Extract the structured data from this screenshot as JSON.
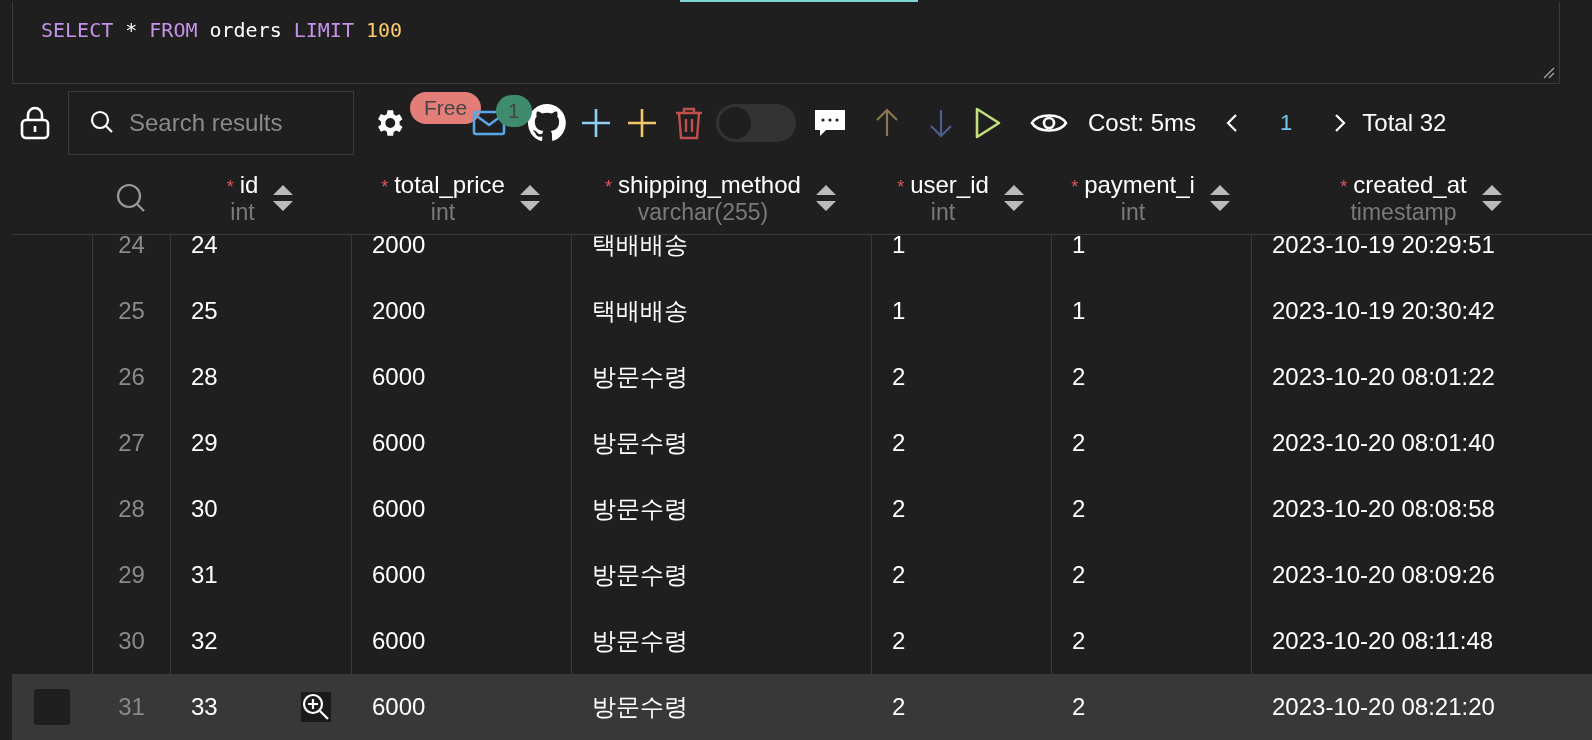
{
  "query": {
    "tokens": [
      {
        "kind": "keyword",
        "text": "SELECT"
      },
      {
        "kind": "plain",
        "text": "*"
      },
      {
        "kind": "keyword",
        "text": "FROM"
      },
      {
        "kind": "plain",
        "text": "orders"
      },
      {
        "kind": "keyword",
        "text": "LIMIT"
      },
      {
        "kind": "number",
        "text": "100"
      }
    ]
  },
  "toolbar": {
    "search": {
      "placeholder": "Search results"
    },
    "plan_badge": "Free",
    "mail_badge": "1",
    "toggle": {
      "on": false
    },
    "cost": "Cost: 5ms",
    "page": "1",
    "total": "Total 32"
  },
  "table": {
    "columns": [
      {
        "name": "id",
        "type": "int",
        "required": true
      },
      {
        "name": "total_price",
        "type": "int",
        "required": true
      },
      {
        "name": "shipping_method",
        "type": "varchar(255)",
        "required": true
      },
      {
        "name": "user_id",
        "type": "int",
        "required": true
      },
      {
        "name": "payment_i",
        "type": "int",
        "required": true
      },
      {
        "name": "created_at",
        "type": "timestamp",
        "required": true
      }
    ],
    "rows": [
      {
        "index": "24",
        "selected": false,
        "cells": [
          "24",
          "2000",
          "택배배송",
          "1",
          "1",
          "2023-10-19 20:29:51"
        ]
      },
      {
        "index": "25",
        "selected": false,
        "cells": [
          "25",
          "2000",
          "택배배송",
          "1",
          "1",
          "2023-10-19 20:30:42"
        ]
      },
      {
        "index": "26",
        "selected": false,
        "cells": [
          "28",
          "6000",
          "방문수령",
          "2",
          "2",
          "2023-10-20 08:01:22"
        ]
      },
      {
        "index": "27",
        "selected": false,
        "cells": [
          "29",
          "6000",
          "방문수령",
          "2",
          "2",
          "2023-10-20 08:01:40"
        ]
      },
      {
        "index": "28",
        "selected": false,
        "cells": [
          "30",
          "6000",
          "방문수령",
          "2",
          "2",
          "2023-10-20 08:08:58"
        ]
      },
      {
        "index": "29",
        "selected": false,
        "cells": [
          "31",
          "6000",
          "방문수령",
          "2",
          "2",
          "2023-10-20 08:09:26"
        ]
      },
      {
        "index": "30",
        "selected": false,
        "cells": [
          "32",
          "6000",
          "방문수령",
          "2",
          "2",
          "2023-10-20 08:11:48"
        ]
      },
      {
        "index": "31",
        "selected": true,
        "cells": [
          "33",
          "6000",
          "방문수령",
          "2",
          "2",
          "2023-10-20 08:21:20"
        ]
      }
    ]
  }
}
